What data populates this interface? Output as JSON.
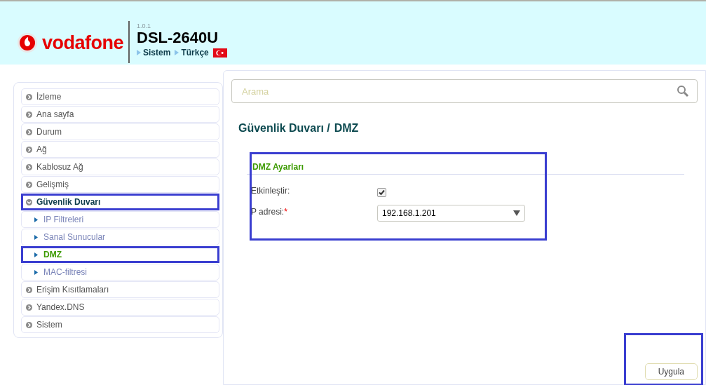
{
  "header": {
    "brand": "vodafone",
    "version": "1.0.1",
    "model": "DSL-2640U",
    "links": [
      {
        "label": "Sistem"
      },
      {
        "label": "Türkçe"
      }
    ]
  },
  "sidebar": {
    "items": [
      {
        "label": "İzleme",
        "expanded": false,
        "selected": false,
        "highlighted": false
      },
      {
        "label": "Ana sayfa",
        "expanded": false,
        "selected": false,
        "highlighted": false
      },
      {
        "label": "Durum",
        "expanded": false,
        "selected": false,
        "highlighted": false
      },
      {
        "label": "Ağ",
        "expanded": false,
        "selected": false,
        "highlighted": false
      },
      {
        "label": "Kablosuz Ağ",
        "expanded": false,
        "selected": false,
        "highlighted": false
      },
      {
        "label": "Gelişmiş",
        "expanded": false,
        "selected": false,
        "highlighted": false
      },
      {
        "label": "Güvenlik Duvarı",
        "expanded": true,
        "selected": false,
        "highlighted": true,
        "children": [
          {
            "label": "IP Filtreleri",
            "selected": false,
            "highlighted": false
          },
          {
            "label": "Sanal Sunucular",
            "selected": false,
            "highlighted": false
          },
          {
            "label": "DMZ",
            "selected": true,
            "highlighted": true
          },
          {
            "label": "MAC-filtresi",
            "selected": false,
            "highlighted": false
          }
        ]
      },
      {
        "label": "Erişim Kısıtlamaları",
        "expanded": false,
        "selected": false,
        "highlighted": false
      },
      {
        "label": "Yandex.DNS",
        "expanded": false,
        "selected": false,
        "highlighted": false
      },
      {
        "label": "Sistem",
        "expanded": false,
        "selected": false,
        "highlighted": false
      }
    ]
  },
  "search": {
    "placeholder": "Arama"
  },
  "breadcrumb": [
    "Güvenlik Duvarı /",
    "DMZ"
  ],
  "section": {
    "title": "DMZ Ayarları",
    "highlighted": true,
    "fields": [
      {
        "kind": "checkbox",
        "label": "Etkinleştir:",
        "checked": true
      },
      {
        "kind": "select",
        "label": "P adresi:",
        "required": "*",
        "value": "192.168.1.201"
      }
    ]
  },
  "apply_button": {
    "label": "Uygula",
    "highlighted": true
  }
}
